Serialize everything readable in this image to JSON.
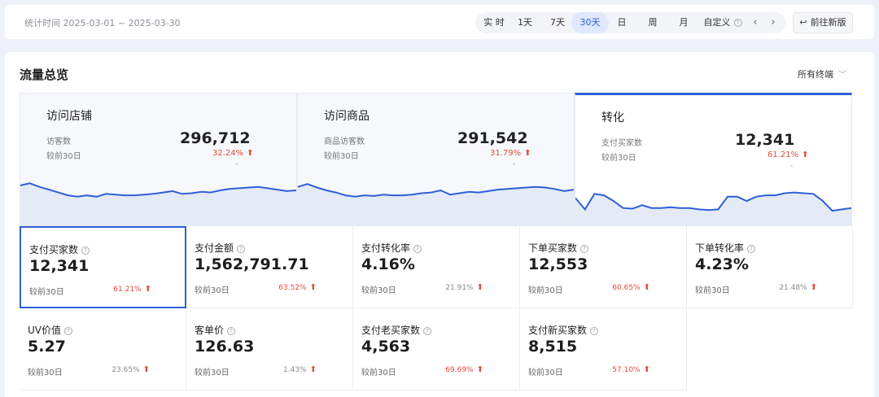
{
  "header": {
    "date_range": "统计时间 2025-03-01 ~ 2025-03-30",
    "tabs": [
      {
        "label": "实 时"
      },
      {
        "label": "1天"
      },
      {
        "label": "7天"
      },
      {
        "label": "30天",
        "active": true
      },
      {
        "label": "日"
      },
      {
        "label": "周"
      },
      {
        "label": "月"
      },
      {
        "label": "自定义"
      }
    ],
    "prev_icon": "chevron-left-icon",
    "next_icon": "chevron-right-icon",
    "new_version_button": "前往新版",
    "accent_color": "#2f5fd6"
  },
  "panel": {
    "title": "流量总览",
    "terminal_filter": "所有终端"
  },
  "cards": [
    {
      "title": "访问店铺",
      "metric_label": "访客数",
      "value": "296,712",
      "compare_label": "较前30日",
      "change": "32.24%",
      "direction": "up",
      "dash": "-",
      "active": false,
      "trend": [
        52,
        55,
        50,
        46,
        42,
        38,
        36,
        38,
        36,
        40,
        39,
        38,
        38,
        39,
        40,
        42,
        44,
        40,
        41,
        43,
        42,
        45,
        47,
        48,
        49,
        50,
        48,
        46,
        44,
        45
      ]
    },
    {
      "title": "访问商品",
      "metric_label": "商品访客数",
      "value": "291,542",
      "compare_label": "较前30日",
      "change": "31.79%",
      "direction": "up",
      "dash": "-",
      "active": false,
      "trend": [
        50,
        54,
        49,
        45,
        42,
        38,
        36,
        38,
        37,
        39,
        38,
        38,
        39,
        41,
        42,
        45,
        39,
        41,
        43,
        42,
        44,
        46,
        47,
        48,
        49,
        50,
        49,
        47,
        44,
        46
      ]
    },
    {
      "title": "转化",
      "metric_label": "支付买家数",
      "value": "12,341",
      "compare_label": "较前30日",
      "change": "61.21%",
      "direction": "up",
      "dash": "-",
      "active": true,
      "trend": [
        34,
        18,
        40,
        38,
        30,
        20,
        19,
        24,
        20,
        20,
        21,
        20,
        20,
        18,
        17,
        18,
        36,
        36,
        30,
        36,
        38,
        38,
        41,
        42,
        41,
        40,
        30,
        16,
        18,
        20
      ]
    }
  ],
  "metrics": [
    {
      "label": "支付买家数",
      "value": "12,341",
      "compare_label": "较前30日",
      "change": "61.21%",
      "color": "red",
      "arrow": true,
      "selected": true
    },
    {
      "label": "支付金额",
      "value": "1,562,791.71",
      "compare_label": "较前30日",
      "change": "63.52%",
      "color": "red",
      "arrow": true
    },
    {
      "label": "支付转化率",
      "value": "4.16%",
      "compare_label": "较前30日",
      "change": "21.91%",
      "color": "gray",
      "arrow": true
    },
    {
      "label": "下单买家数",
      "value": "12,553",
      "compare_label": "较前30日",
      "change": "60.65%",
      "color": "red",
      "arrow": true
    },
    {
      "label": "下单转化率",
      "value": "4.23%",
      "compare_label": "较前30日",
      "change": "21.48%",
      "color": "gray",
      "arrow": true
    },
    {
      "label": "UV价值",
      "value": "5.27",
      "compare_label": "较前30日",
      "change": "23.65%",
      "color": "gray",
      "arrow": true
    },
    {
      "label": "客单价",
      "value": "126.63",
      "compare_label": "较前30日",
      "change": "1.43%",
      "color": "gray",
      "arrow": true
    },
    {
      "label": "支付老买家数",
      "value": "4,563",
      "compare_label": "较前30日",
      "change": "69.69%",
      "color": "red",
      "arrow": true
    },
    {
      "label": "支付新买家数",
      "value": "8,515",
      "compare_label": "较前30日",
      "change": "57.10%",
      "color": "red",
      "arrow": true
    }
  ]
}
